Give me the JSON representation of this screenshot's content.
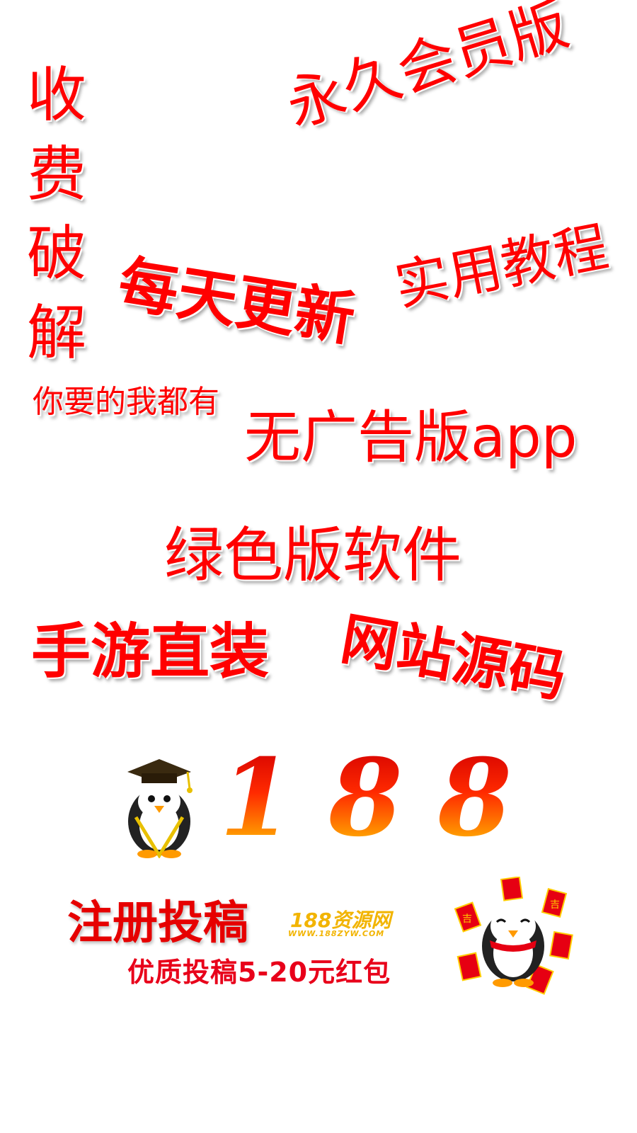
{
  "phrases": {
    "vertical_chars": [
      "收",
      "费",
      "破",
      "解"
    ],
    "permanent_vip": "永久会员版",
    "daily_update": "每天更新",
    "practical_tutorial": "实用教程",
    "have_everything": "你要的我都有",
    "no_ads_app": "无广告版app",
    "green_software": "绿色版软件",
    "mobile_game": "手游直装",
    "website_source": "网站源码"
  },
  "logo": {
    "number": "188"
  },
  "banner": {
    "title": "注册投稿",
    "site_name": "188资源网",
    "site_url": "WWW.188ZYW.COM",
    "promo": "优质投稿5-20元红包",
    "envelope_char": "吉"
  },
  "colors": {
    "primary_red": "#ff0000",
    "banner_red": "#e60000",
    "gold": "#f2b400"
  }
}
